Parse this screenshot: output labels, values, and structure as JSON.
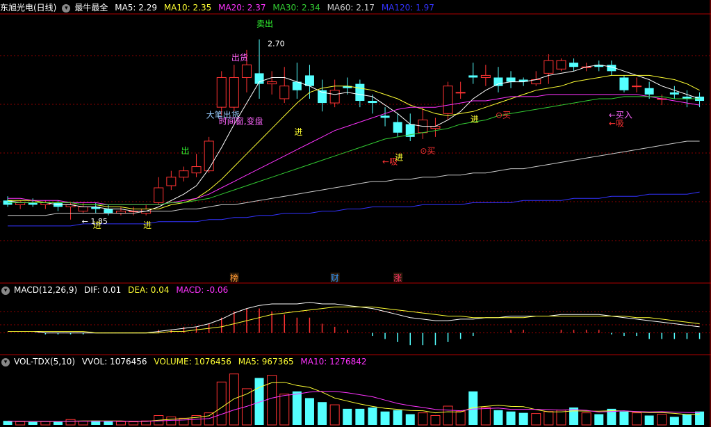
{
  "header": {
    "stock": "东旭光电(日线)",
    "formula": "最牛最全",
    "ma": [
      {
        "label": "MA5: 2.29",
        "color": "#ffffff"
      },
      {
        "label": "MA10: 2.35",
        "color": "#ffff33"
      },
      {
        "label": "MA20: 2.37",
        "color": "#ff33ff"
      },
      {
        "label": "MA30: 2.34",
        "color": "#33cc33"
      },
      {
        "label": "MA60: 2.17",
        "color": "#cccccc"
      },
      {
        "label": "MA120: 1.97",
        "color": "#3333ff"
      }
    ]
  },
  "macd_header": {
    "name": "MACD(12,26,9)",
    "dif": "DIF: 0.01",
    "dea": "DEA: 0.04",
    "macd": "MACD: -0.06"
  },
  "vol_header": {
    "name": "VOL-TDX(5,10)",
    "vvol": "VVOL: 1076456",
    "volume": "VOLUME: 1076456",
    "ma5": "MA5: 967365",
    "ma10": "MA10: 1276842"
  },
  "colors": {
    "up": "#ff3333",
    "down": "#54ffff",
    "ma5": "#ffffff",
    "ma10": "#ffff33",
    "ma20": "#ff33ff",
    "ma30": "#33cc33",
    "ma60": "#cccccc",
    "ma120": "#3333ff",
    "grid": "#8b0000"
  },
  "chart_data": {
    "type": "candlestick",
    "y_range": [
      1.6,
      2.82
    ],
    "max_label": "2.70",
    "min_label": "1.85",
    "candles": [
      [
        1.94,
        1.92,
        1.96,
        1.91
      ],
      [
        1.92,
        1.93,
        1.94,
        1.9
      ],
      [
        1.93,
        1.92,
        1.95,
        1.91
      ],
      [
        1.92,
        1.93,
        1.94,
        1.9
      ],
      [
        1.93,
        1.91,
        1.94,
        1.89
      ],
      [
        1.91,
        1.92,
        1.93,
        1.85
      ],
      [
        1.89,
        1.91,
        1.93,
        1.88
      ],
      [
        1.91,
        1.9,
        1.93,
        1.88
      ],
      [
        1.9,
        1.88,
        1.92,
        1.87
      ],
      [
        1.88,
        1.89,
        1.91,
        1.87
      ],
      [
        1.89,
        1.89,
        1.91,
        1.87
      ],
      [
        1.88,
        1.9,
        1.92,
        1.87
      ],
      [
        1.93,
        2.0,
        2.05,
        1.92
      ],
      [
        2.01,
        2.05,
        2.08,
        1.99
      ],
      [
        2.05,
        2.08,
        2.1,
        2.03
      ],
      [
        2.07,
        2.1,
        2.16,
        2.05
      ],
      [
        2.08,
        2.22,
        2.24,
        2.07
      ],
      [
        2.38,
        2.52,
        2.55,
        2.34
      ],
      [
        2.38,
        2.52,
        2.58,
        2.36
      ],
      [
        2.52,
        2.58,
        2.65,
        2.45
      ],
      [
        2.54,
        2.49,
        2.7,
        2.42
      ],
      [
        2.49,
        2.5,
        2.55,
        2.44
      ],
      [
        2.42,
        2.48,
        2.57,
        2.4
      ],
      [
        2.5,
        2.46,
        2.59,
        2.42
      ],
      [
        2.53,
        2.48,
        2.58,
        2.42
      ],
      [
        2.46,
        2.4,
        2.51,
        2.36
      ],
      [
        2.4,
        2.46,
        2.51,
        2.38
      ],
      [
        2.48,
        2.47,
        2.52,
        2.44
      ],
      [
        2.49,
        2.41,
        2.51,
        2.38
      ],
      [
        2.41,
        2.4,
        2.44,
        2.35
      ],
      [
        2.34,
        2.33,
        2.38,
        2.29
      ],
      [
        2.31,
        2.26,
        2.35,
        2.24
      ],
      [
        2.3,
        2.24,
        2.35,
        2.22
      ],
      [
        2.26,
        2.32,
        2.38,
        2.23
      ],
      [
        2.28,
        2.29,
        2.33,
        2.24
      ],
      [
        2.35,
        2.48,
        2.5,
        2.32
      ],
      [
        2.45,
        2.45,
        2.5,
        2.42
      ],
      [
        2.53,
        2.52,
        2.59,
        2.49
      ],
      [
        2.52,
        2.53,
        2.58,
        2.48
      ],
      [
        2.52,
        2.48,
        2.57,
        2.45
      ],
      [
        2.52,
        2.5,
        2.55,
        2.47
      ],
      [
        2.51,
        2.5,
        2.52,
        2.48
      ],
      [
        2.49,
        2.51,
        2.55,
        2.48
      ],
      [
        2.54,
        2.6,
        2.63,
        2.49
      ],
      [
        2.56,
        2.6,
        2.61,
        2.55
      ],
      [
        2.59,
        2.57,
        2.61,
        2.55
      ],
      [
        2.57,
        2.57,
        2.59,
        2.55
      ],
      [
        2.58,
        2.57,
        2.6,
        2.55
      ],
      [
        2.58,
        2.55,
        2.6,
        2.53
      ],
      [
        2.52,
        2.46,
        2.53,
        2.45
      ],
      [
        2.48,
        2.48,
        2.52,
        2.45
      ],
      [
        2.47,
        2.44,
        2.5,
        2.42
      ],
      [
        2.42,
        2.42,
        2.44,
        2.39
      ],
      [
        2.45,
        2.44,
        2.48,
        2.42
      ],
      [
        2.43,
        2.42,
        2.46,
        2.38
      ],
      [
        2.43,
        2.41,
        2.45,
        2.38
      ]
    ],
    "ma_series": [
      {
        "key": "ma5",
        "values": [
          1.94,
          1.93,
          1.93,
          1.93,
          1.92,
          1.92,
          1.91,
          1.91,
          1.9,
          1.9,
          1.89,
          1.89,
          1.91,
          1.94,
          1.97,
          2.01,
          2.09,
          2.19,
          2.3,
          2.4,
          2.5,
          2.52,
          2.52,
          2.5,
          2.48,
          2.45,
          2.44,
          2.45,
          2.44,
          2.43,
          2.39,
          2.35,
          2.3,
          2.29,
          2.29,
          2.32,
          2.36,
          2.42,
          2.46,
          2.49,
          2.5,
          2.5,
          2.51,
          2.53,
          2.54,
          2.55,
          2.57,
          2.58,
          2.57,
          2.55,
          2.53,
          2.51,
          2.48,
          2.46,
          2.44,
          2.42
        ]
      },
      {
        "key": "ma10",
        "values": [
          1.94,
          1.94,
          1.94,
          1.93,
          1.93,
          1.93,
          1.92,
          1.92,
          1.91,
          1.91,
          1.9,
          1.9,
          1.9,
          1.92,
          1.93,
          1.95,
          1.99,
          2.04,
          2.1,
          2.16,
          2.22,
          2.28,
          2.34,
          2.4,
          2.45,
          2.47,
          2.48,
          2.48,
          2.47,
          2.46,
          2.44,
          2.42,
          2.39,
          2.37,
          2.35,
          2.34,
          2.35,
          2.36,
          2.38,
          2.4,
          2.42,
          2.44,
          2.46,
          2.47,
          2.48,
          2.5,
          2.51,
          2.52,
          2.53,
          2.53,
          2.53,
          2.53,
          2.52,
          2.51,
          2.49,
          2.46
        ]
      },
      {
        "key": "ma20",
        "values": [
          1.95,
          1.95,
          1.94,
          1.94,
          1.94,
          1.93,
          1.93,
          1.93,
          1.92,
          1.92,
          1.92,
          1.92,
          1.92,
          1.93,
          1.94,
          1.95,
          1.97,
          2.0,
          2.03,
          2.06,
          2.09,
          2.12,
          2.15,
          2.18,
          2.21,
          2.24,
          2.27,
          2.29,
          2.31,
          2.33,
          2.35,
          2.37,
          2.38,
          2.38,
          2.38,
          2.39,
          2.4,
          2.41,
          2.41,
          2.42,
          2.43,
          2.43,
          2.43,
          2.44,
          2.44,
          2.44,
          2.44,
          2.44,
          2.44,
          2.44,
          2.44,
          2.43,
          2.42,
          2.41,
          2.4,
          2.39
        ]
      },
      {
        "key": "ma30",
        "values": [
          1.93,
          1.93,
          1.93,
          1.93,
          1.93,
          1.93,
          1.92,
          1.92,
          1.92,
          1.92,
          1.92,
          1.92,
          1.92,
          1.93,
          1.93,
          1.94,
          1.95,
          1.97,
          1.99,
          2.01,
          2.03,
          2.05,
          2.07,
          2.09,
          2.11,
          2.13,
          2.15,
          2.17,
          2.19,
          2.21,
          2.23,
          2.24,
          2.25,
          2.26,
          2.27,
          2.28,
          2.3,
          2.31,
          2.32,
          2.34,
          2.35,
          2.36,
          2.37,
          2.38,
          2.39,
          2.4,
          2.41,
          2.42,
          2.42,
          2.43,
          2.43,
          2.43,
          2.43,
          2.42,
          2.42,
          2.42
        ]
      },
      {
        "key": "ma60",
        "values": [
          1.87,
          1.87,
          1.87,
          1.87,
          1.88,
          1.88,
          1.88,
          1.88,
          1.88,
          1.88,
          1.88,
          1.89,
          1.89,
          1.89,
          1.9,
          1.9,
          1.91,
          1.92,
          1.92,
          1.93,
          1.94,
          1.95,
          1.96,
          1.97,
          1.98,
          1.99,
          2.0,
          2.01,
          2.02,
          2.03,
          2.03,
          2.04,
          2.04,
          2.05,
          2.05,
          2.06,
          2.06,
          2.07,
          2.07,
          2.08,
          2.09,
          2.09,
          2.1,
          2.11,
          2.12,
          2.13,
          2.14,
          2.15,
          2.16,
          2.17,
          2.18,
          2.19,
          2.2,
          2.21,
          2.22,
          2.22
        ]
      },
      {
        "key": "ma120",
        "values": [
          1.82,
          1.82,
          1.82,
          1.82,
          1.82,
          1.82,
          1.83,
          1.83,
          1.83,
          1.83,
          1.83,
          1.83,
          1.84,
          1.84,
          1.84,
          1.84,
          1.85,
          1.85,
          1.86,
          1.86,
          1.87,
          1.87,
          1.88,
          1.88,
          1.88,
          1.89,
          1.89,
          1.9,
          1.9,
          1.91,
          1.91,
          1.91,
          1.91,
          1.92,
          1.92,
          1.92,
          1.92,
          1.93,
          1.93,
          1.93,
          1.93,
          1.94,
          1.94,
          1.94,
          1.94,
          1.95,
          1.95,
          1.95,
          1.96,
          1.96,
          1.96,
          1.97,
          1.97,
          1.97,
          1.97,
          1.98
        ]
      }
    ],
    "annotations": [
      {
        "text": "进",
        "i": 7,
        "price": 1.81,
        "color": "#ffff33"
      },
      {
        "text": "进",
        "i": 11,
        "price": 1.81,
        "color": "#ffff33"
      },
      {
        "text": "出",
        "i": 14,
        "price": 2.16,
        "color": "#33ff33"
      },
      {
        "text": "大笔出货",
        "i": 16,
        "price": 2.33,
        "color": "#99ccff"
      },
      {
        "text": "时间窗,变盘",
        "i": 17,
        "price": 2.3,
        "color": "#ff66ff"
      },
      {
        "text": "出货",
        "i": 18,
        "price": 2.6,
        "color": "#ff66ff"
      },
      {
        "text": "卖出",
        "i": 20,
        "price": 2.76,
        "color": "#33ff33"
      },
      {
        "text": "进",
        "i": 23,
        "price": 2.25,
        "color": "#ffff33"
      },
      {
        "text": "←吸",
        "i": 30,
        "price": 2.11,
        "color": "#ff3333"
      },
      {
        "text": "进",
        "i": 31,
        "price": 2.13,
        "color": "#ffff33"
      },
      {
        "text": "⊙买",
        "i": 33,
        "price": 2.16,
        "color": "#ff3333"
      },
      {
        "text": "进",
        "i": 37,
        "price": 2.31,
        "color": "#ffff33"
      },
      {
        "text": "⊙买",
        "i": 39,
        "price": 2.33,
        "color": "#ff3333"
      },
      {
        "text": "←买入",
        "i": 48,
        "price": 2.33,
        "color": "#ff66ff"
      },
      {
        "text": "←吸",
        "i": 48,
        "price": 2.29,
        "color": "#ff3333"
      }
    ],
    "bottom_labels": [
      {
        "text": "榜",
        "i": 18,
        "color": "#ff9933"
      },
      {
        "text": "财",
        "i": 26,
        "color": "#3399ff"
      },
      {
        "text": "涨",
        "i": 31,
        "color": "#ff3366"
      }
    ],
    "macd": {
      "y_range": [
        -0.12,
        0.24
      ],
      "dif": [
        0.01,
        0.01,
        0.01,
        0.0,
        0.0,
        0.0,
        0.0,
        0.0,
        0.0,
        0.0,
        0.0,
        0.0,
        0.01,
        0.02,
        0.03,
        0.04,
        0.06,
        0.09,
        0.13,
        0.16,
        0.18,
        0.19,
        0.19,
        0.19,
        0.2,
        0.19,
        0.19,
        0.18,
        0.17,
        0.16,
        0.14,
        0.12,
        0.1,
        0.09,
        0.08,
        0.08,
        0.09,
        0.09,
        0.1,
        0.1,
        0.11,
        0.11,
        0.11,
        0.11,
        0.12,
        0.12,
        0.12,
        0.12,
        0.11,
        0.1,
        0.09,
        0.08,
        0.07,
        0.06,
        0.05,
        0.04
      ],
      "dea": [
        0.01,
        0.01,
        0.01,
        0.01,
        0.01,
        0.01,
        0.01,
        0.0,
        0.0,
        0.0,
        0.0,
        0.0,
        0.0,
        0.01,
        0.01,
        0.02,
        0.03,
        0.04,
        0.06,
        0.08,
        0.1,
        0.12,
        0.13,
        0.14,
        0.15,
        0.16,
        0.17,
        0.17,
        0.17,
        0.17,
        0.16,
        0.15,
        0.14,
        0.13,
        0.12,
        0.11,
        0.11,
        0.1,
        0.1,
        0.1,
        0.1,
        0.1,
        0.11,
        0.11,
        0.11,
        0.11,
        0.11,
        0.11,
        0.11,
        0.11,
        0.1,
        0.1,
        0.09,
        0.08,
        0.07,
        0.06
      ],
      "hist": [
        0.0,
        0.0,
        0.0,
        -0.01,
        -0.01,
        -0.01,
        -0.01,
        0.0,
        0.0,
        0.0,
        0.0,
        0.0,
        0.02,
        0.02,
        0.04,
        0.04,
        0.06,
        0.1,
        0.14,
        0.16,
        0.16,
        0.14,
        0.12,
        0.1,
        0.1,
        0.06,
        0.04,
        0.02,
        0.0,
        -0.02,
        -0.04,
        -0.06,
        -0.08,
        -0.08,
        -0.08,
        -0.06,
        -0.04,
        -0.02,
        0.0,
        0.0,
        0.02,
        0.02,
        0.0,
        0.0,
        0.02,
        0.02,
        0.02,
        0.02,
        -0.01,
        -0.02,
        -0.02,
        -0.04,
        -0.04,
        -0.04,
        -0.04,
        -0.04
      ]
    },
    "volume": {
      "y_range": [
        0,
        4200000
      ],
      "values": [
        300000,
        250000,
        220000,
        250000,
        230000,
        400000,
        280000,
        320000,
        260000,
        250000,
        230000,
        300000,
        700000,
        600000,
        500000,
        700000,
        900000,
        3200000,
        3800000,
        2700000,
        3500000,
        3700000,
        2300000,
        2500000,
        2000000,
        1700000,
        1500000,
        1200000,
        1200000,
        1300000,
        1000000,
        1100000,
        800000,
        900000,
        700000,
        1400000,
        1000000,
        2500000,
        1300000,
        1100000,
        1000000,
        900000,
        850000,
        1000000,
        1100000,
        1300000,
        900000,
        800000,
        1200000,
        1000000,
        900000,
        700000,
        800000,
        600000,
        800000,
        1000000
      ],
      "ma5": [
        280000,
        270000,
        260000,
        260000,
        250000,
        280000,
        300000,
        300000,
        300000,
        300000,
        260000,
        260000,
        350000,
        420000,
        480000,
        560000,
        680000,
        1300000,
        1950000,
        2300000,
        2800000,
        3150000,
        3180000,
        2940000,
        2800000,
        2440000,
        2000000,
        1780000,
        1560000,
        1380000,
        1240000,
        1160000,
        1080000,
        1060000,
        900000,
        980000,
        960000,
        1300000,
        1380000,
        1460000,
        1380000,
        1360000,
        1140000,
        970000,
        970000,
        1050000,
        1030000,
        1020000,
        1060000,
        1040000,
        960000,
        920000,
        920000,
        860000,
        770000,
        780000
      ],
      "ma10": [
        290000,
        280000,
        270000,
        270000,
        260000,
        270000,
        280000,
        280000,
        280000,
        280000,
        270000,
        270000,
        300000,
        340000,
        370000,
        420000,
        470000,
        800000,
        1120000,
        1380000,
        1700000,
        2000000,
        2200000,
        2300000,
        2450000,
        2500000,
        2500000,
        2400000,
        2250000,
        2100000,
        1850000,
        1600000,
        1430000,
        1300000,
        1150000,
        1100000,
        1060000,
        1180000,
        1220000,
        1260000,
        1160000,
        1160000,
        1160000,
        1140000,
        1110000,
        1140000,
        1090000,
        960000,
        1000000,
        1050000,
        1000000,
        970000,
        990000,
        960000,
        930000,
        910000
      ]
    }
  }
}
